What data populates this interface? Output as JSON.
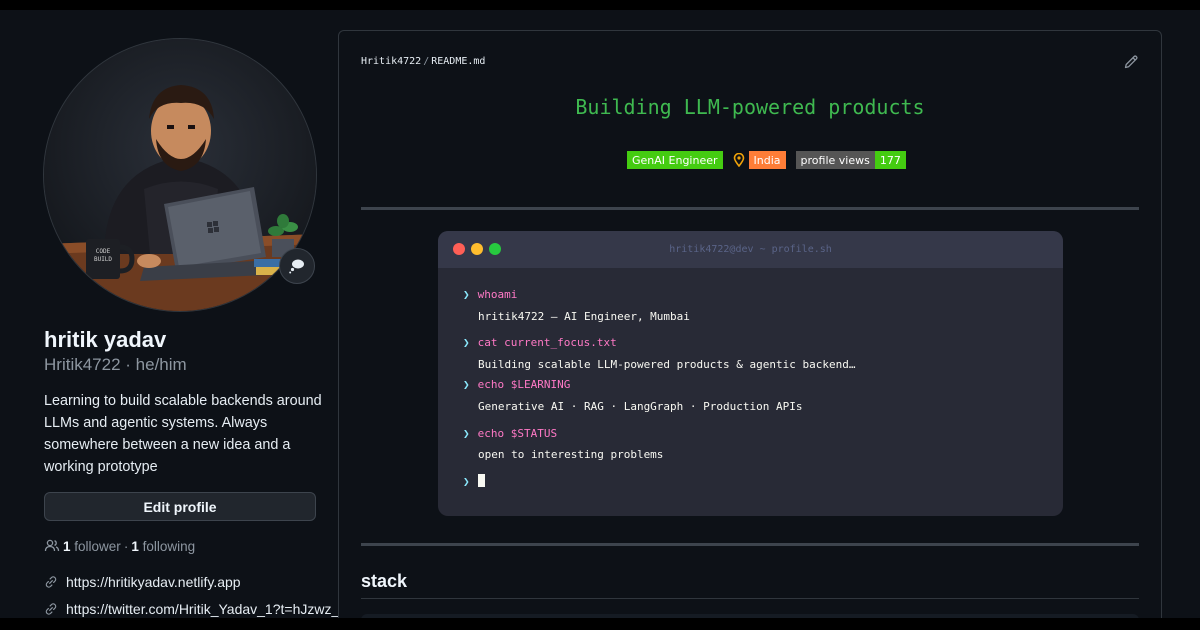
{
  "profile": {
    "name": "hritik yadav",
    "login": "Hritik4722",
    "pronouns": "he/him",
    "bio": "Learning to build scalable backends around LLMs and agentic systems. Always somewhere between a new idea and a working prototype",
    "edit_label": "Edit profile",
    "followers_count": "1",
    "followers_label": "follower",
    "following_count": "1",
    "following_label": "following",
    "links": [
      "https://hritikyadav.netlify.app",
      "https://twitter.com/Hritik_Yadav_1?t=hJzwz_"
    ],
    "avatar_mug_text": "CODE BUILD"
  },
  "readme": {
    "owner": "Hritik4722",
    "file": "README.md",
    "headline": "Building LLM-powered products",
    "badges": {
      "role": "GenAI Engineer",
      "location": "India",
      "views_label": "profile views",
      "views_count": "177"
    },
    "terminal": {
      "title": "hritik4722@dev ~ profile.sh",
      "lines": [
        {
          "cmd": "whoami",
          "out": "hritik4722 — AI Engineer, Mumbai"
        },
        {
          "cmd": "cat current_focus.txt",
          "out": "Building scalable LLM-powered products & agentic backend…"
        },
        {
          "cmd": "echo $LEARNING",
          "out": "Generative AI · RAG · LangGraph · Production APIs"
        },
        {
          "cmd": "echo $STATUS",
          "out": "open to interesting problems"
        }
      ],
      "prompt_symbol": "❯"
    },
    "stack_heading": "stack"
  },
  "colors": {
    "accent_green": "#3fb950",
    "badge_green": "#44cc11",
    "badge_orange": "#fe7d37",
    "terminal_bg": "#282a36"
  }
}
